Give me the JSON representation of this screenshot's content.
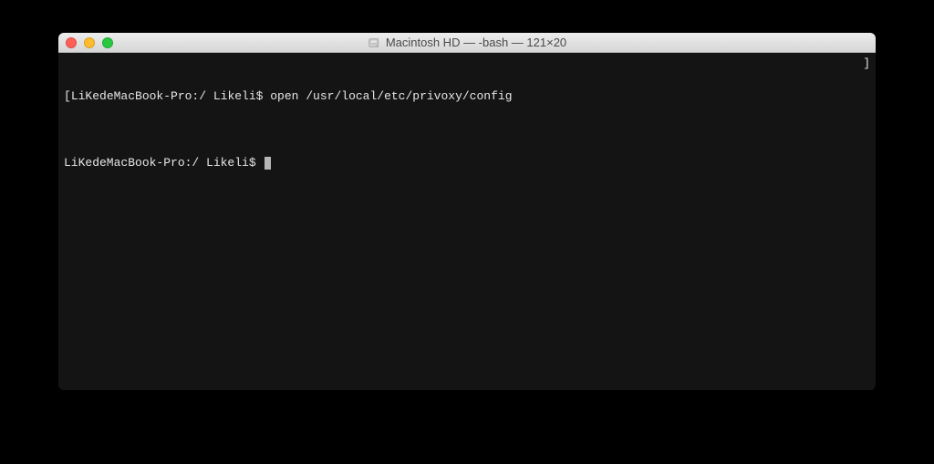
{
  "titlebar": {
    "title": "Macintosh HD — -bash — 121×20"
  },
  "terminal": {
    "lines": [
      {
        "left_symbol": "[",
        "prompt": "LiKedeMacBook-Pro:/ Likeli$ ",
        "command": "open /usr/local/etc/privoxy/config",
        "right_symbol": "]"
      },
      {
        "left_symbol": "",
        "prompt": "LiKedeMacBook-Pro:/ Likeli$ ",
        "command": "",
        "right_symbol": ""
      }
    ]
  }
}
